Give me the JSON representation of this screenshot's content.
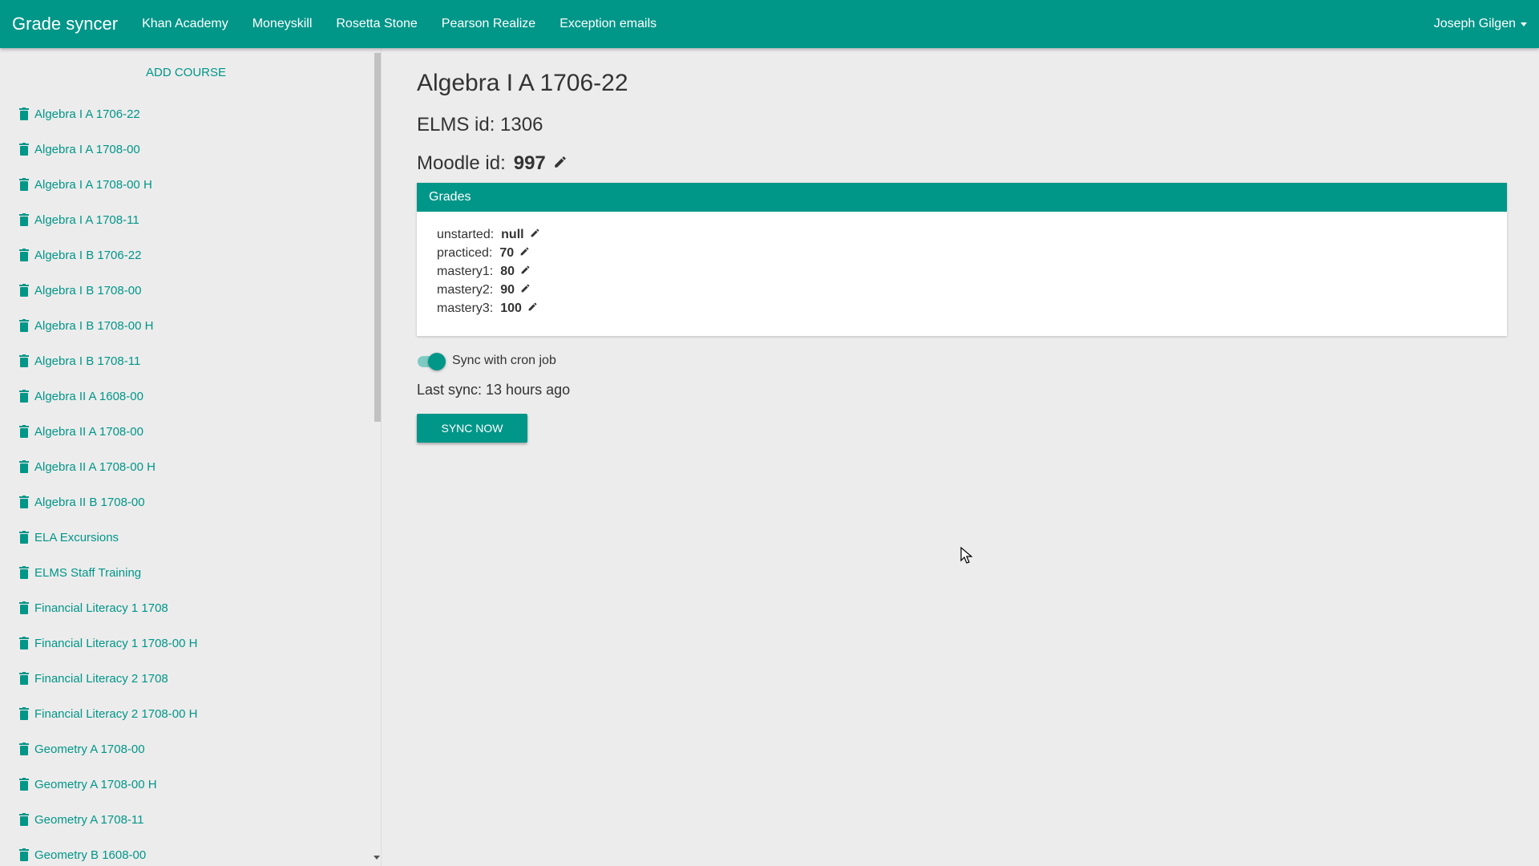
{
  "nav": {
    "brand": "Grade syncer",
    "links": [
      "Khan Academy",
      "Moneyskill",
      "Rosetta Stone",
      "Pearson Realize",
      "Exception emails"
    ],
    "user": "Joseph Gilgen"
  },
  "sidebar": {
    "add_course": "ADD COURSE",
    "courses": [
      "Algebra I A 1706-22",
      "Algebra I A 1708-00",
      "Algebra I A 1708-00 H",
      "Algebra I A 1708-11",
      "Algebra I B 1706-22",
      "Algebra I B 1708-00",
      "Algebra I B 1708-00 H",
      "Algebra I B 1708-11",
      "Algebra II A 1608-00",
      "Algebra II A 1708-00",
      "Algebra II A 1708-00 H",
      "Algebra II B 1708-00",
      "ELA Excursions",
      "ELMS Staff Training",
      "Financial Literacy 1 1708",
      "Financial Literacy 1 1708-00 H",
      "Financial Literacy 2 1708",
      "Financial Literacy 2 1708-00 H",
      "Geometry A 1708-00",
      "Geometry A 1708-00 H",
      "Geometry A 1708-11",
      "Geometry B 1608-00"
    ]
  },
  "main": {
    "title": "Algebra I A 1706-22",
    "elms_label": "ELMS id: 1306",
    "moodle_label": "Moodle id:",
    "moodle_value": "997",
    "grades_heading": "Grades",
    "grades": [
      {
        "key": "unstarted:",
        "value": "null"
      },
      {
        "key": "practiced:",
        "value": "70"
      },
      {
        "key": "mastery1:",
        "value": "80"
      },
      {
        "key": "mastery2:",
        "value": "90"
      },
      {
        "key": "mastery3:",
        "value": "100"
      }
    ],
    "sync_toggle_label": "Sync with cron job",
    "sync_toggle_on": true,
    "last_sync": "Last sync: 13 hours ago",
    "sync_button": "SYNC NOW"
  },
  "icons": {
    "delete": "trash-icon",
    "edit": "pencil-icon",
    "dropdown": "caret-down-icon"
  },
  "colors": {
    "primary": "#009688",
    "background": "#ececec"
  }
}
